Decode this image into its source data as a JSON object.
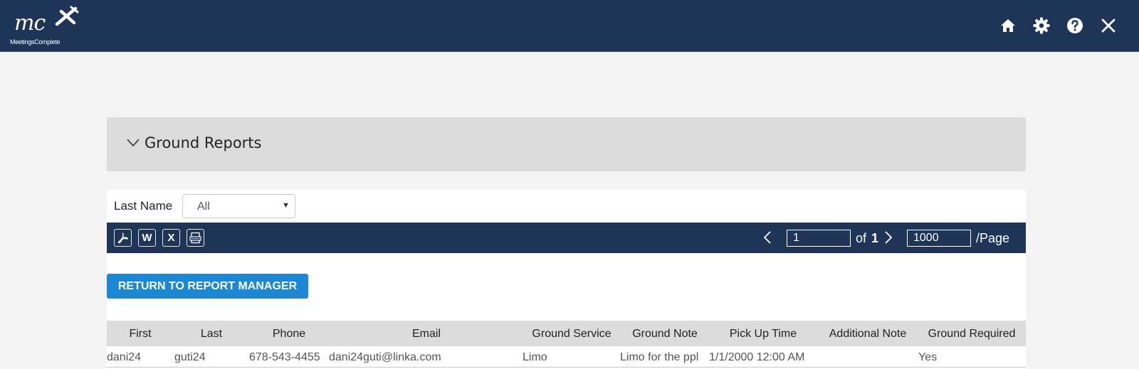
{
  "brand": {
    "mark": "mc",
    "name": "MeetingsComplete"
  },
  "top_nav": {
    "icons": [
      "home-icon",
      "gear-icon",
      "help-icon",
      "close-icon"
    ]
  },
  "panel": {
    "title": "Ground Reports"
  },
  "filter": {
    "label": "Last Name",
    "selected": "All"
  },
  "toolbar": {
    "exports": [
      "pdf-icon",
      "word-icon",
      "excel-icon",
      "csv-icon"
    ],
    "excel_glyph": "X",
    "word_glyph": "W",
    "page": "1",
    "of_label": "of",
    "total_pages": "1",
    "page_size": "1000",
    "page_size_unit": "/Page"
  },
  "return_button": "RETURN TO REPORT MANAGER",
  "table": {
    "columns": [
      "First",
      "Last",
      "Phone",
      "Email",
      "Ground Service",
      "Ground Note",
      "Pick Up Time",
      "Additional Note",
      "Ground Required"
    ],
    "rows": [
      [
        "dani24",
        "guti24",
        "678-543-4455",
        "dani24guti@linka.com",
        "Limo",
        "Limo for the ppl",
        "1/1/2000 12:00 AM",
        "",
        "Yes"
      ]
    ]
  },
  "colors": {
    "nav_bg": "#1e3557",
    "accent_button": "#1a88d4",
    "page_bg": "#f4f4f4",
    "panel_bg": "#dcdcdc"
  }
}
